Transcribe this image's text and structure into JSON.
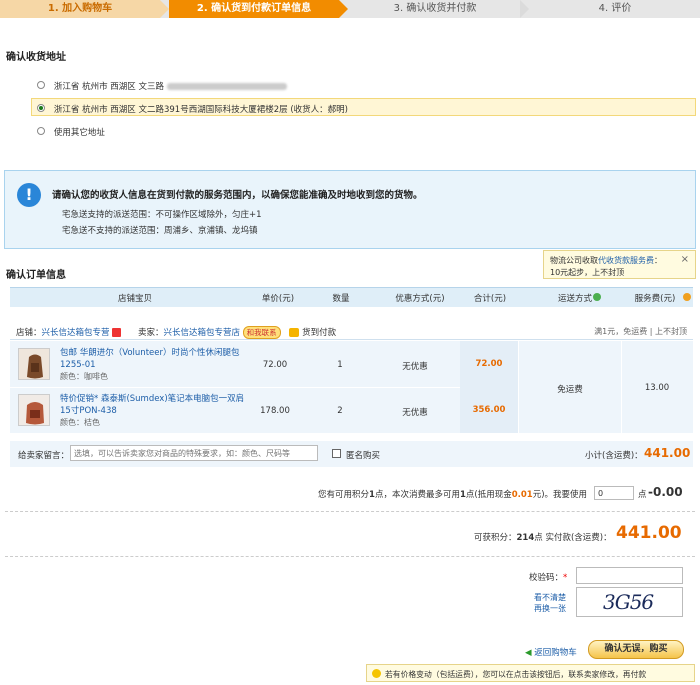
{
  "steps": [
    {
      "label": "1. 加入购物车"
    },
    {
      "label": "2. 确认货到付款订单信息"
    },
    {
      "label": "3. 确认收货并付款"
    },
    {
      "label": "4. 评价"
    }
  ],
  "address": {
    "heading": "确认收货地址",
    "options": [
      {
        "text": "浙江省 杭州市 西湖区 文三路"
      },
      {
        "text": "浙江省 杭州市 西湖区 文二路391号西湖国际科技大厦裙楼2层 (收货人：郝明)"
      },
      {
        "text": "使用其它地址"
      }
    ]
  },
  "notice": {
    "title": "请确认您的收货人信息在货到付款的服务范围内，以确保您能准确及时地收到您的货物。",
    "line1": "宅急送支持的派送范围：不可操作区域除外，匀庄+1",
    "line2": "宅急送不支持的派送范围：周浦乡、京浦镇、龙坞镇"
  },
  "order": {
    "heading": "确认订单信息",
    "tip": {
      "text_a": "物流公司收取",
      "link": "代收货款服务费",
      "text_b": "：",
      "line2": "10元起步，上不封顶",
      "close": "×"
    },
    "columns": [
      "店铺宝贝",
      "单价(元)",
      "数量",
      "优惠方式(元)",
      "合计(元)",
      "运送方式",
      "服务费(元)"
    ],
    "shop": {
      "label": "店铺：",
      "name": "兴长信达箱包专营",
      "seller_label": "卖家：",
      "seller": "兴长信达箱包专营店",
      "chat": "和我联系",
      "cod": "货到付款",
      "fee_note": "满1元，免运费 | 上不封顶"
    },
    "items": [
      {
        "title": "包邮 华朗进尔（Volunteer）时尚个性休闲腿包1255-01",
        "color": "颜色：咖啡色",
        "price": "72.00",
        "qty": "1",
        "discount": "无优惠",
        "total": "72.00"
      },
      {
        "title": "特价促销* 森泰斯(Sumdex)笔记本电脑包一双肩15寸PON-438",
        "color": "颜色：桔色",
        "price": "178.00",
        "qty": "2",
        "discount": "无优惠",
        "total": "356.00"
      }
    ],
    "shipping": "免运费",
    "service_fee": "13.00",
    "message_label": "给卖家留言：",
    "message_placeholder": "选填，可以告诉卖家您对商品的特殊要求，如：颜色、尺码等",
    "anonymous": "匿名购买",
    "subtotal_label": "小计(含运费)：",
    "subtotal": "441.00"
  },
  "points": {
    "text_a": "您有可用积分",
    "avail": "1",
    "text_b": "点，本次消费最多可用",
    "max": "1",
    "text_c": "点(抵用现金",
    "cash": "0.01",
    "text_d": "元)。我要使用",
    "input_value": "0",
    "text_e": "点",
    "deduct": "-0.00"
  },
  "summary": {
    "earn_label": "可获积分：",
    "earn": "214",
    "earn_unit": "点",
    "pay_label": "实付款(含运费)：",
    "pay": "441.00"
  },
  "captcha": {
    "label": "校验码：",
    "required": "*",
    "refresh_a": "看不清楚",
    "refresh_b": "再换一张",
    "code": "3G56"
  },
  "actions": {
    "back": "返回购物车",
    "confirm": "确认无误，购买"
  },
  "warning": "若有价格变动（包括运费），您可以在点击该按钮后，联系卖家修改，再付款"
}
